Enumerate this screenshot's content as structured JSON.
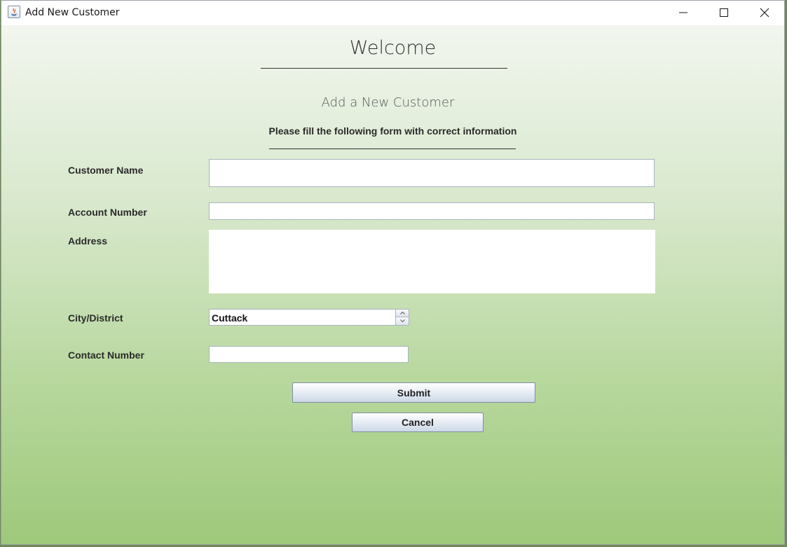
{
  "window": {
    "title": "Add New Customer",
    "controls": [
      "minimize-icon",
      "maximize-icon",
      "close-icon"
    ]
  },
  "header": {
    "welcome": "Welcome",
    "subtitle": "Add a New Customer",
    "instruction": "Please fill the following form with correct information"
  },
  "form": {
    "customer_name": {
      "label": "Customer Name",
      "value": ""
    },
    "account_number": {
      "label": "Account Number",
      "value": ""
    },
    "address": {
      "label": "Address",
      "value": ""
    },
    "city": {
      "label": "City/District",
      "value": "Cuttack"
    },
    "contact": {
      "label": "Contact Number",
      "value": ""
    }
  },
  "buttons": {
    "submit": "Submit",
    "cancel": "Cancel"
  }
}
